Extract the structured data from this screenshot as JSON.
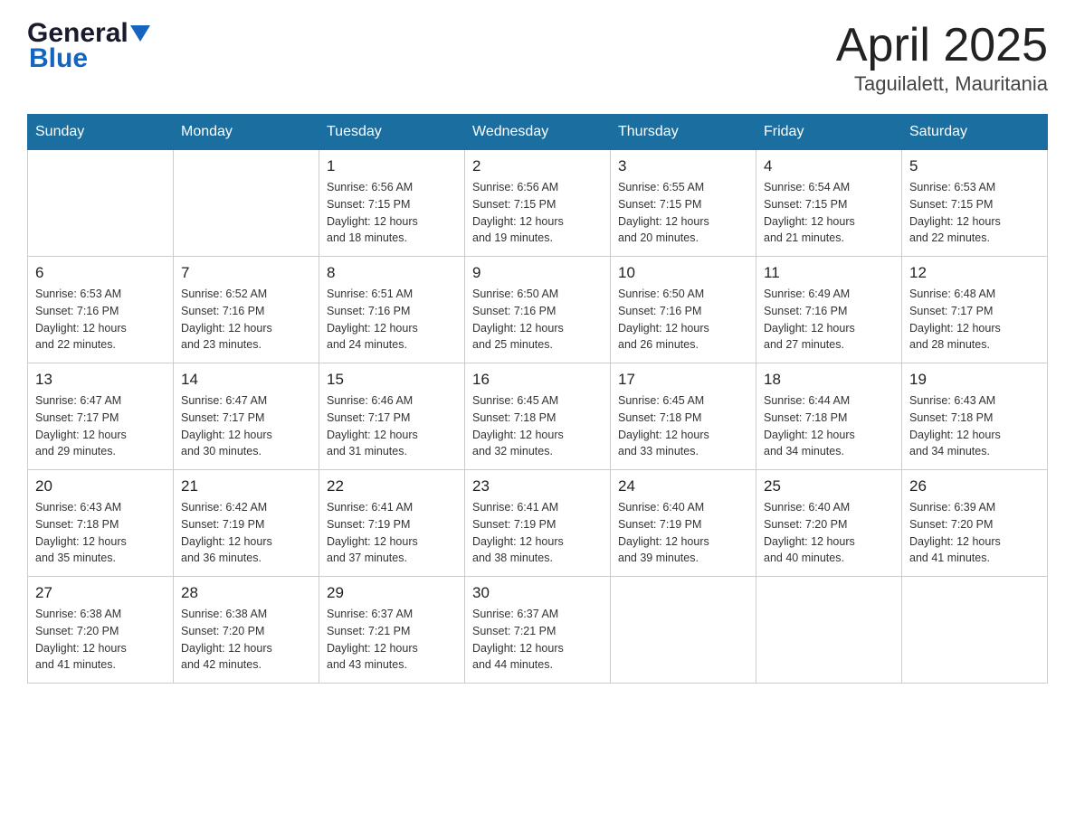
{
  "header": {
    "logo_general": "General",
    "logo_blue": "Blue",
    "title": "April 2025",
    "subtitle": "Taguilalett, Mauritania"
  },
  "weekdays": [
    "Sunday",
    "Monday",
    "Tuesday",
    "Wednesday",
    "Thursday",
    "Friday",
    "Saturday"
  ],
  "weeks": [
    [
      {
        "day": "",
        "info": ""
      },
      {
        "day": "",
        "info": ""
      },
      {
        "day": "1",
        "info": "Sunrise: 6:56 AM\nSunset: 7:15 PM\nDaylight: 12 hours\nand 18 minutes."
      },
      {
        "day": "2",
        "info": "Sunrise: 6:56 AM\nSunset: 7:15 PM\nDaylight: 12 hours\nand 19 minutes."
      },
      {
        "day": "3",
        "info": "Sunrise: 6:55 AM\nSunset: 7:15 PM\nDaylight: 12 hours\nand 20 minutes."
      },
      {
        "day": "4",
        "info": "Sunrise: 6:54 AM\nSunset: 7:15 PM\nDaylight: 12 hours\nand 21 minutes."
      },
      {
        "day": "5",
        "info": "Sunrise: 6:53 AM\nSunset: 7:15 PM\nDaylight: 12 hours\nand 22 minutes."
      }
    ],
    [
      {
        "day": "6",
        "info": "Sunrise: 6:53 AM\nSunset: 7:16 PM\nDaylight: 12 hours\nand 22 minutes."
      },
      {
        "day": "7",
        "info": "Sunrise: 6:52 AM\nSunset: 7:16 PM\nDaylight: 12 hours\nand 23 minutes."
      },
      {
        "day": "8",
        "info": "Sunrise: 6:51 AM\nSunset: 7:16 PM\nDaylight: 12 hours\nand 24 minutes."
      },
      {
        "day": "9",
        "info": "Sunrise: 6:50 AM\nSunset: 7:16 PM\nDaylight: 12 hours\nand 25 minutes."
      },
      {
        "day": "10",
        "info": "Sunrise: 6:50 AM\nSunset: 7:16 PM\nDaylight: 12 hours\nand 26 minutes."
      },
      {
        "day": "11",
        "info": "Sunrise: 6:49 AM\nSunset: 7:16 PM\nDaylight: 12 hours\nand 27 minutes."
      },
      {
        "day": "12",
        "info": "Sunrise: 6:48 AM\nSunset: 7:17 PM\nDaylight: 12 hours\nand 28 minutes."
      }
    ],
    [
      {
        "day": "13",
        "info": "Sunrise: 6:47 AM\nSunset: 7:17 PM\nDaylight: 12 hours\nand 29 minutes."
      },
      {
        "day": "14",
        "info": "Sunrise: 6:47 AM\nSunset: 7:17 PM\nDaylight: 12 hours\nand 30 minutes."
      },
      {
        "day": "15",
        "info": "Sunrise: 6:46 AM\nSunset: 7:17 PM\nDaylight: 12 hours\nand 31 minutes."
      },
      {
        "day": "16",
        "info": "Sunrise: 6:45 AM\nSunset: 7:18 PM\nDaylight: 12 hours\nand 32 minutes."
      },
      {
        "day": "17",
        "info": "Sunrise: 6:45 AM\nSunset: 7:18 PM\nDaylight: 12 hours\nand 33 minutes."
      },
      {
        "day": "18",
        "info": "Sunrise: 6:44 AM\nSunset: 7:18 PM\nDaylight: 12 hours\nand 34 minutes."
      },
      {
        "day": "19",
        "info": "Sunrise: 6:43 AM\nSunset: 7:18 PM\nDaylight: 12 hours\nand 34 minutes."
      }
    ],
    [
      {
        "day": "20",
        "info": "Sunrise: 6:43 AM\nSunset: 7:18 PM\nDaylight: 12 hours\nand 35 minutes."
      },
      {
        "day": "21",
        "info": "Sunrise: 6:42 AM\nSunset: 7:19 PM\nDaylight: 12 hours\nand 36 minutes."
      },
      {
        "day": "22",
        "info": "Sunrise: 6:41 AM\nSunset: 7:19 PM\nDaylight: 12 hours\nand 37 minutes."
      },
      {
        "day": "23",
        "info": "Sunrise: 6:41 AM\nSunset: 7:19 PM\nDaylight: 12 hours\nand 38 minutes."
      },
      {
        "day": "24",
        "info": "Sunrise: 6:40 AM\nSunset: 7:19 PM\nDaylight: 12 hours\nand 39 minutes."
      },
      {
        "day": "25",
        "info": "Sunrise: 6:40 AM\nSunset: 7:20 PM\nDaylight: 12 hours\nand 40 minutes."
      },
      {
        "day": "26",
        "info": "Sunrise: 6:39 AM\nSunset: 7:20 PM\nDaylight: 12 hours\nand 41 minutes."
      }
    ],
    [
      {
        "day": "27",
        "info": "Sunrise: 6:38 AM\nSunset: 7:20 PM\nDaylight: 12 hours\nand 41 minutes."
      },
      {
        "day": "28",
        "info": "Sunrise: 6:38 AM\nSunset: 7:20 PM\nDaylight: 12 hours\nand 42 minutes."
      },
      {
        "day": "29",
        "info": "Sunrise: 6:37 AM\nSunset: 7:21 PM\nDaylight: 12 hours\nand 43 minutes."
      },
      {
        "day": "30",
        "info": "Sunrise: 6:37 AM\nSunset: 7:21 PM\nDaylight: 12 hours\nand 44 minutes."
      },
      {
        "day": "",
        "info": ""
      },
      {
        "day": "",
        "info": ""
      },
      {
        "day": "",
        "info": ""
      }
    ]
  ]
}
